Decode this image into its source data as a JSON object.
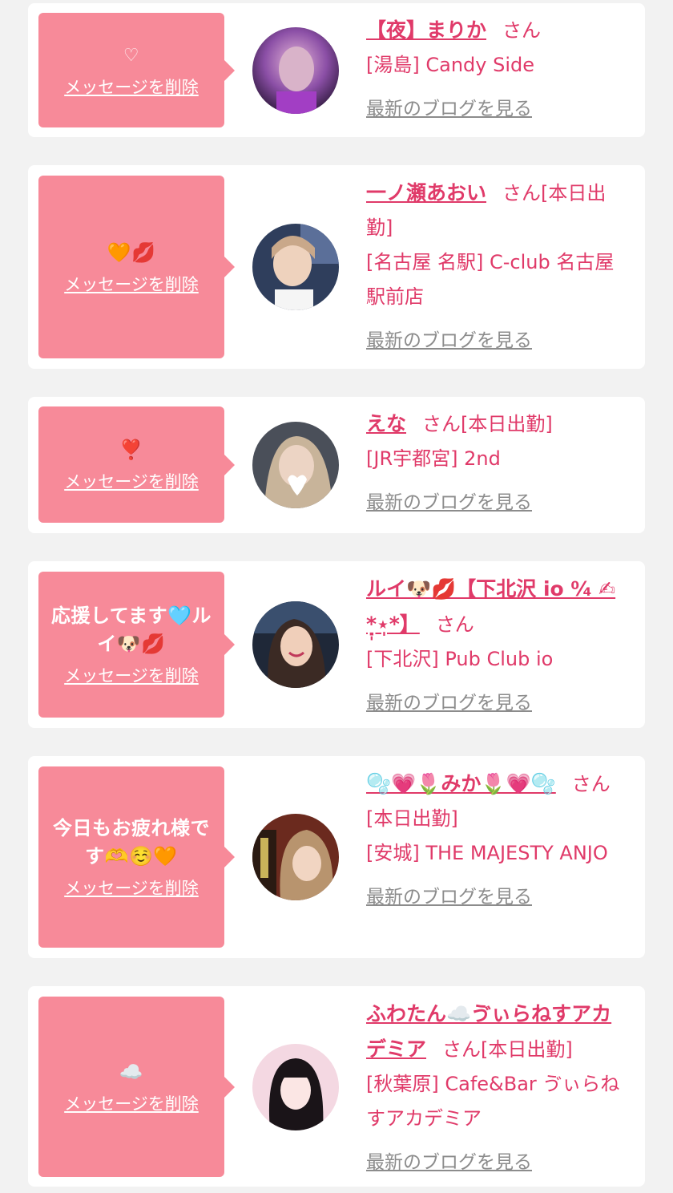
{
  "delete_label": "メッセージを削除",
  "blog_label": "最新のブログを見る",
  "san_label": "さん",
  "cards": [
    {
      "message": "♡",
      "name": "【夜】まりか",
      "status": "",
      "shop": "[湯島] Candy Side"
    },
    {
      "message": "🧡💋",
      "name": "一ノ瀬あおい",
      "status": "[本日出勤]",
      "shop": "[名古屋 名駅] C-club 名古屋駅前店"
    },
    {
      "message": "❣️",
      "name": "えな",
      "status": "[本日出勤]",
      "shop": "[JR宇都宮] 2nd"
    },
    {
      "message": "応援してます🩵ルイ🐶💋",
      "name": "ルイ🐶💋【下北沢 io ⁰⁄₄ ✍︎*̣̩⋆̩*】",
      "status": "",
      "shop": "[下北沢] Pub Club io"
    },
    {
      "message": "今日もお疲れ様です🫶☺️🧡",
      "name": "🫧💗🌷みか🌷💗🫧",
      "status": "[本日出勤]",
      "shop": "[安城] THE MAJESTY ANJO"
    },
    {
      "message": "☁️",
      "name": "ふわたん☁️ゔぃらねすアカデミア",
      "status": "[本日出勤]",
      "shop": "[秋葉原] Cafe&Bar ゔぃらねすアカデミア"
    }
  ]
}
